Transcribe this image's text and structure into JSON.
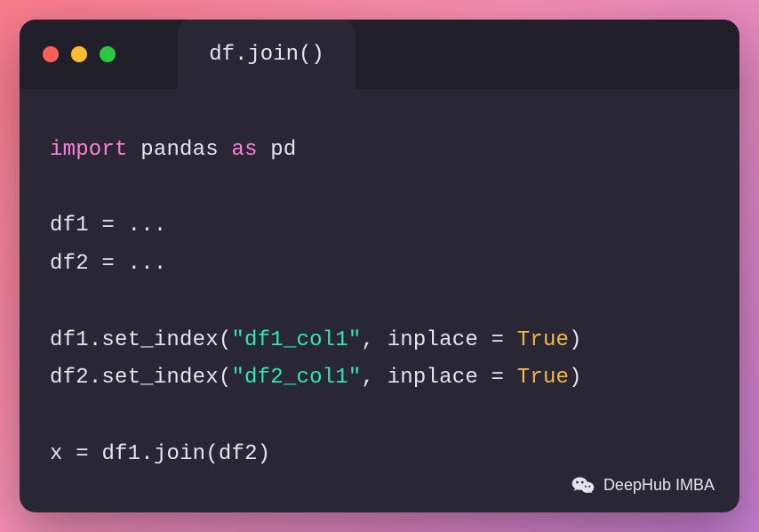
{
  "tab": {
    "title": "df.join()"
  },
  "code": {
    "l1": {
      "kw_import": "import",
      "pandas": "pandas",
      "kw_as": "as",
      "alias": "pd"
    },
    "l3": {
      "lhs": "df1",
      "eq": "=",
      "rhs": "..."
    },
    "l4": {
      "lhs": "df2",
      "eq": "=",
      "rhs": "..."
    },
    "l6": {
      "obj": "df1",
      "dot": ".",
      "fn": "set_index",
      "lp": "(",
      "str": "\"df1_col1\"",
      "comma": ",",
      "arg": "inplace",
      "eq": "=",
      "val": "True",
      "rp": ")"
    },
    "l7": {
      "obj": "df2",
      "dot": ".",
      "fn": "set_index",
      "lp": "(",
      "str": "\"df2_col1\"",
      "comma": ",",
      "arg": "inplace",
      "eq": "=",
      "val": "True",
      "rp": ")"
    },
    "l9": {
      "lhs": "x",
      "eq": "=",
      "obj": "df1",
      "dot": ".",
      "fn": "join",
      "lp": "(",
      "arg": "df2",
      "rp": ")"
    }
  },
  "watermark": {
    "text": "DeepHub IMBA"
  }
}
